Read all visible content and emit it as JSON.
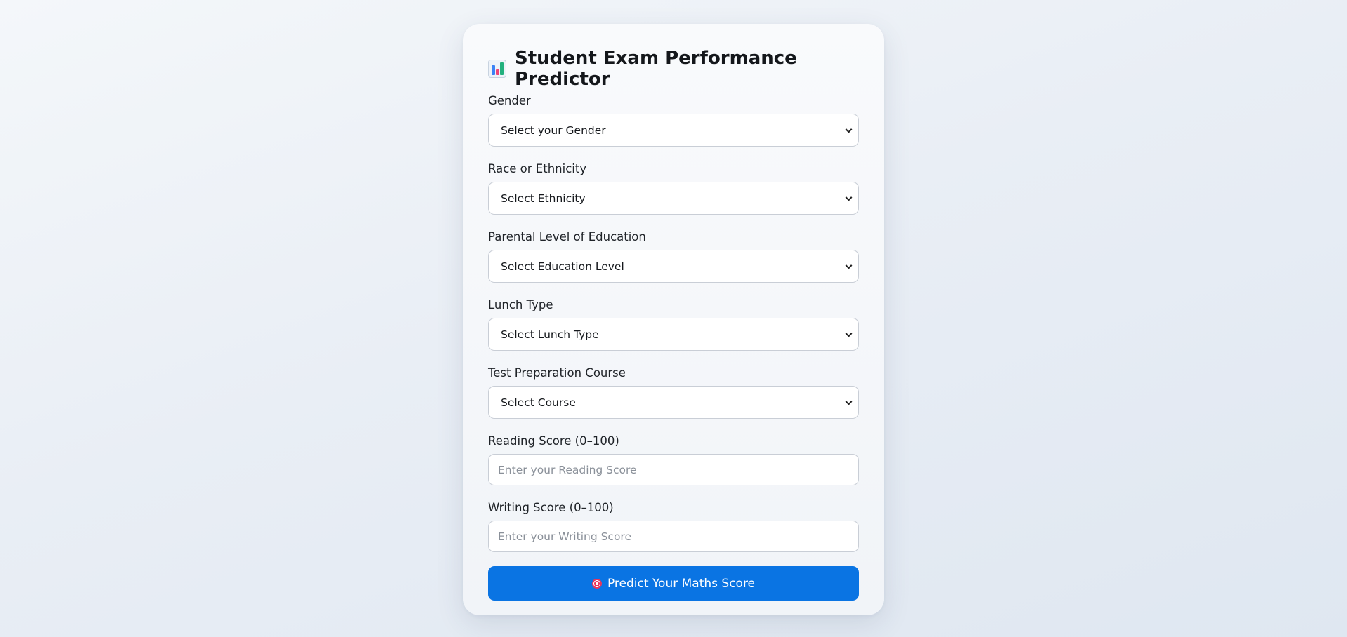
{
  "header": {
    "title": "Student Exam Performance Predictor",
    "icon": "bar-chart-icon"
  },
  "form": {
    "gender": {
      "label": "Gender",
      "value": "Select your Gender"
    },
    "ethnicity": {
      "label": "Race or Ethnicity",
      "value": "Select Ethnicity"
    },
    "education": {
      "label": "Parental Level of Education",
      "value": "Select Education Level"
    },
    "lunch": {
      "label": "Lunch Type",
      "value": "Select Lunch Type"
    },
    "course": {
      "label": "Test Preparation Course",
      "value": "Select Course"
    },
    "reading": {
      "label": "Reading Score (0–100)",
      "placeholder": "Enter your Reading Score",
      "value": ""
    },
    "writing": {
      "label": "Writing Score (0–100)",
      "placeholder": "Enter your Writing Score",
      "value": ""
    },
    "submit": {
      "label": "Predict Your Maths Score",
      "icon": "target-icon"
    }
  },
  "colors": {
    "accent": "#0a74e3",
    "card_background": "#f6f8fb",
    "input_border": "#c9ced6"
  }
}
